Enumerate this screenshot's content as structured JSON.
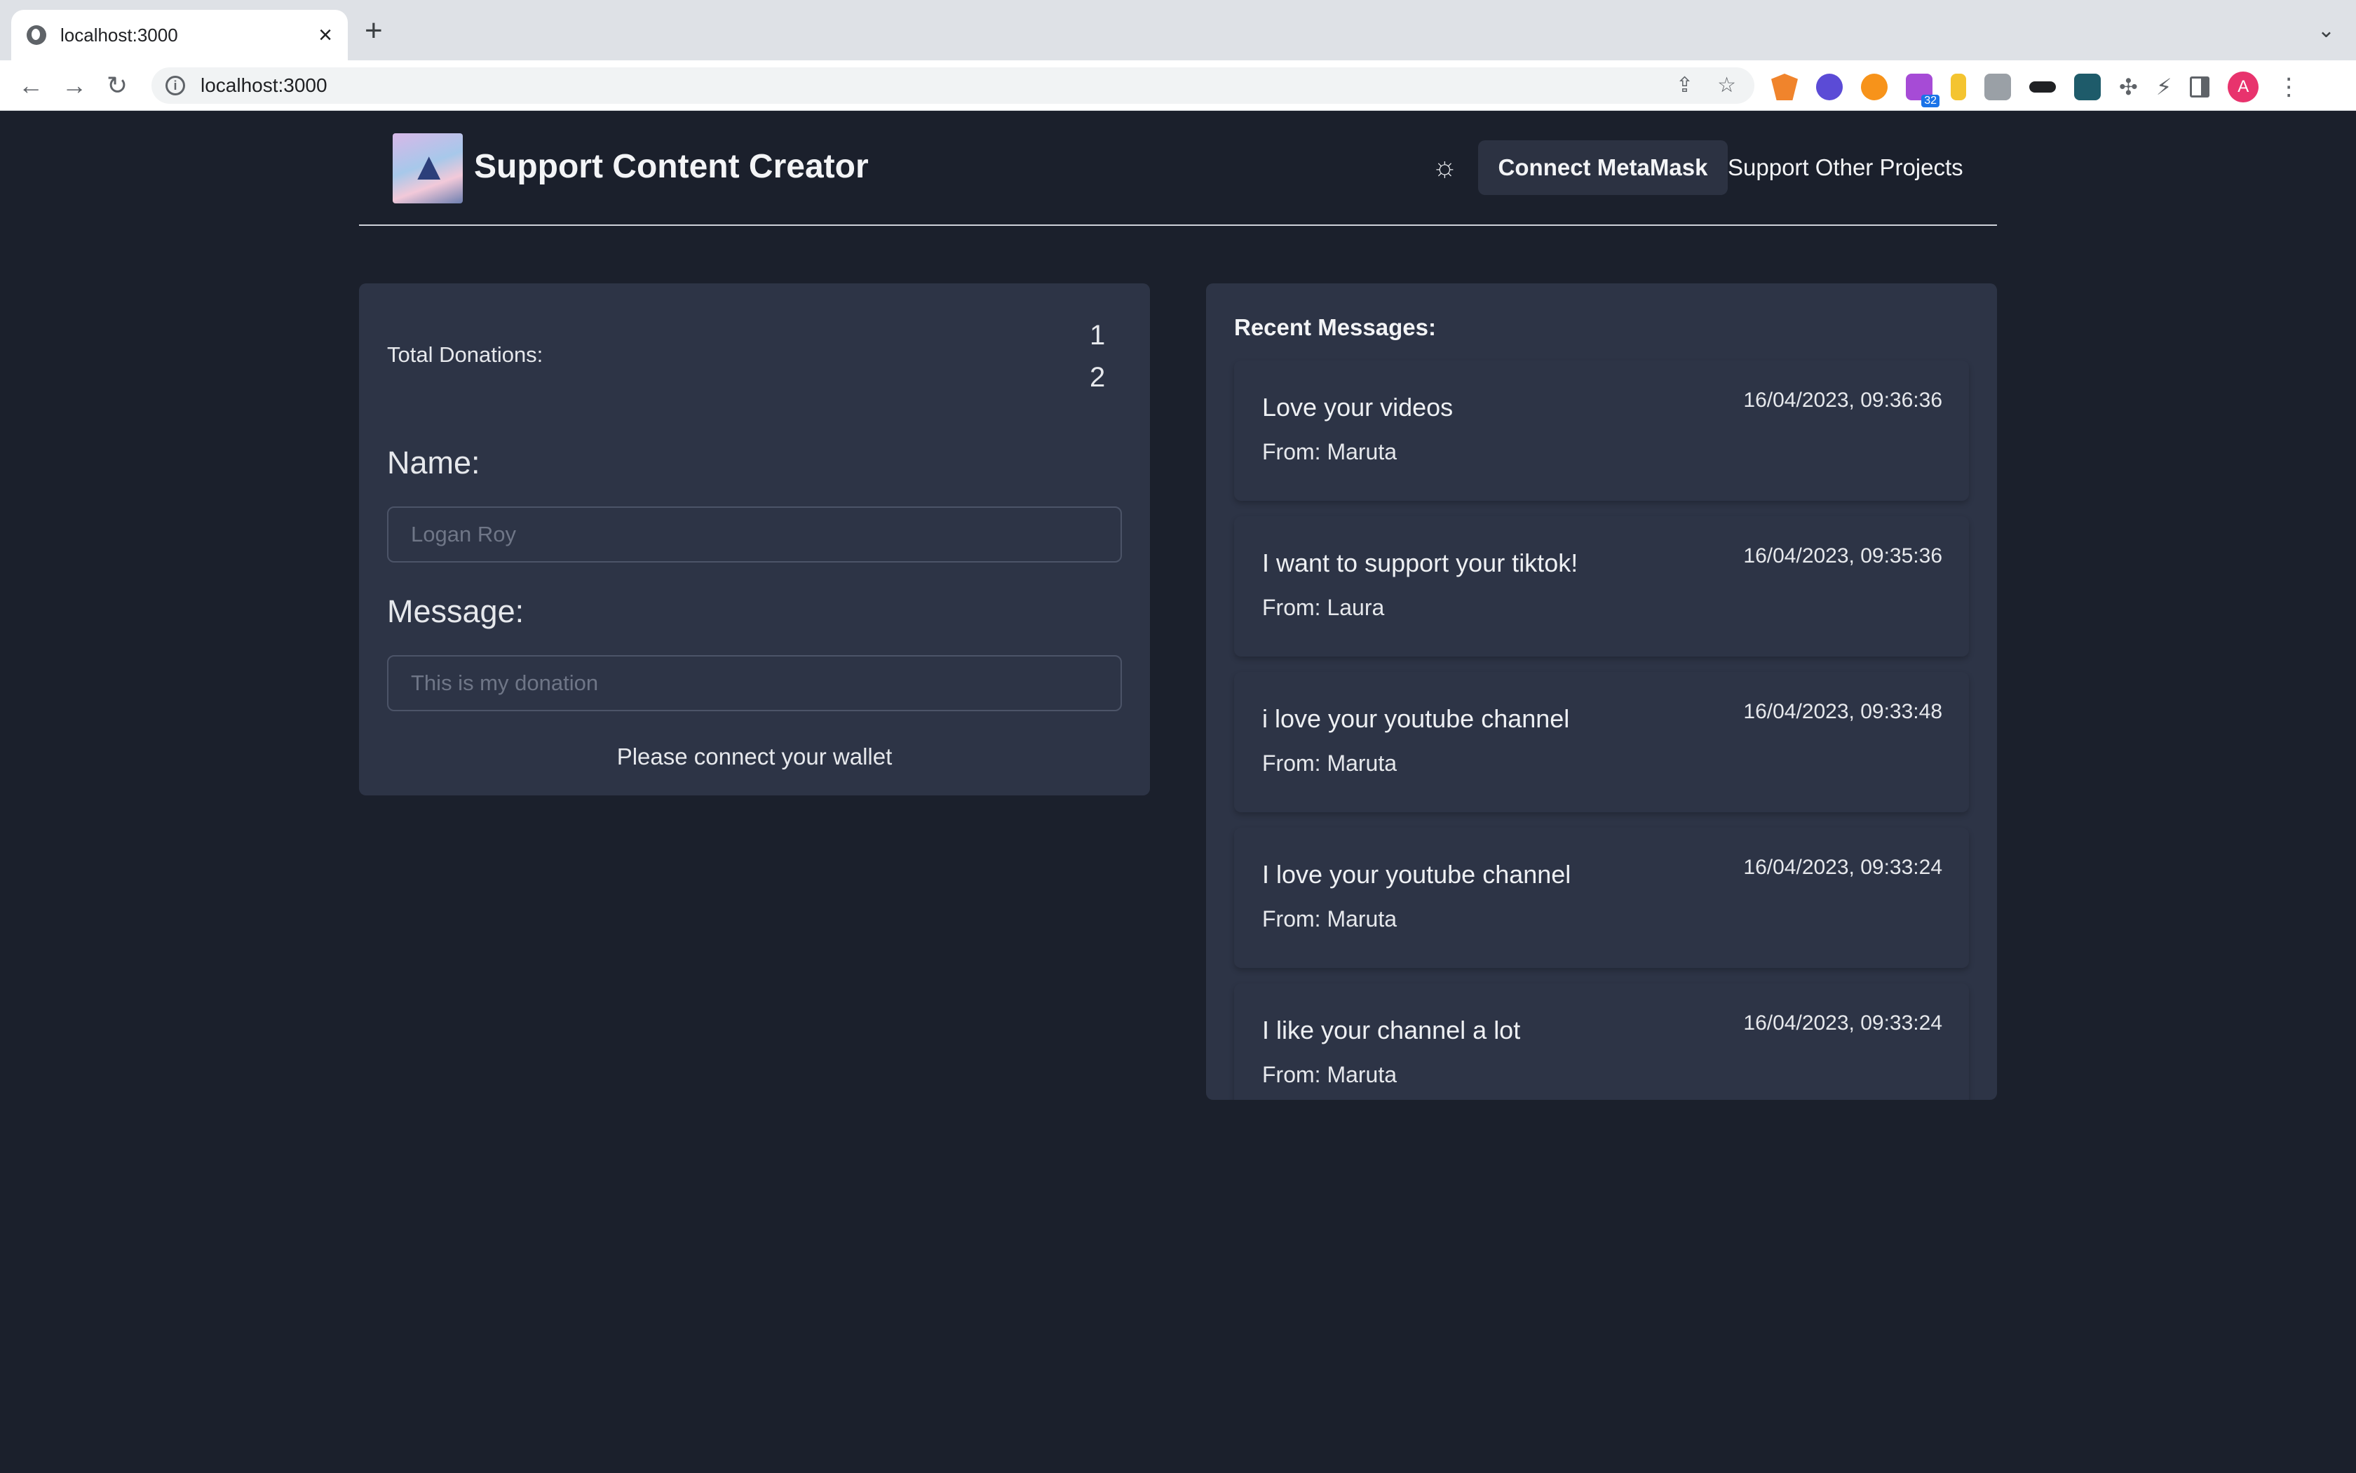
{
  "browser": {
    "tab_title": "localhost:3000",
    "url": "localhost:3000",
    "extension_badge": "32",
    "profile_initial": "A"
  },
  "header": {
    "title": "Support Content Creator",
    "connect_label": "Connect MetaMask",
    "other_projects_label": "Support Other Projects",
    "theme_icon": "sun-icon"
  },
  "donate": {
    "total_label": "Total Donations:",
    "total_value": "12",
    "name_label": "Name:",
    "name_placeholder": "Logan Roy",
    "message_label": "Message:",
    "message_placeholder": "This is my donation",
    "wallet_note": "Please connect your wallet"
  },
  "messages": {
    "title": "Recent Messages:",
    "items": [
      {
        "text": "Love your videos",
        "from": "From: Maruta",
        "time": "16/04/2023, 09:36:36"
      },
      {
        "text": "I want to support your tiktok!",
        "from": "From: Laura",
        "time": "16/04/2023, 09:35:36"
      },
      {
        "text": "i love your youtube channel",
        "from": "From: Maruta",
        "time": "16/04/2023, 09:33:48"
      },
      {
        "text": "I love your youtube channel",
        "from": "From: Maruta",
        "time": "16/04/2023, 09:33:24"
      },
      {
        "text": "I like your channel a lot",
        "from": "From: Maruta",
        "time": "16/04/2023, 09:33:24"
      }
    ]
  },
  "colors": {
    "background": "#1b202c",
    "card": "#2d3446",
    "button": "#2c3242",
    "avatar": "#e8336d"
  }
}
